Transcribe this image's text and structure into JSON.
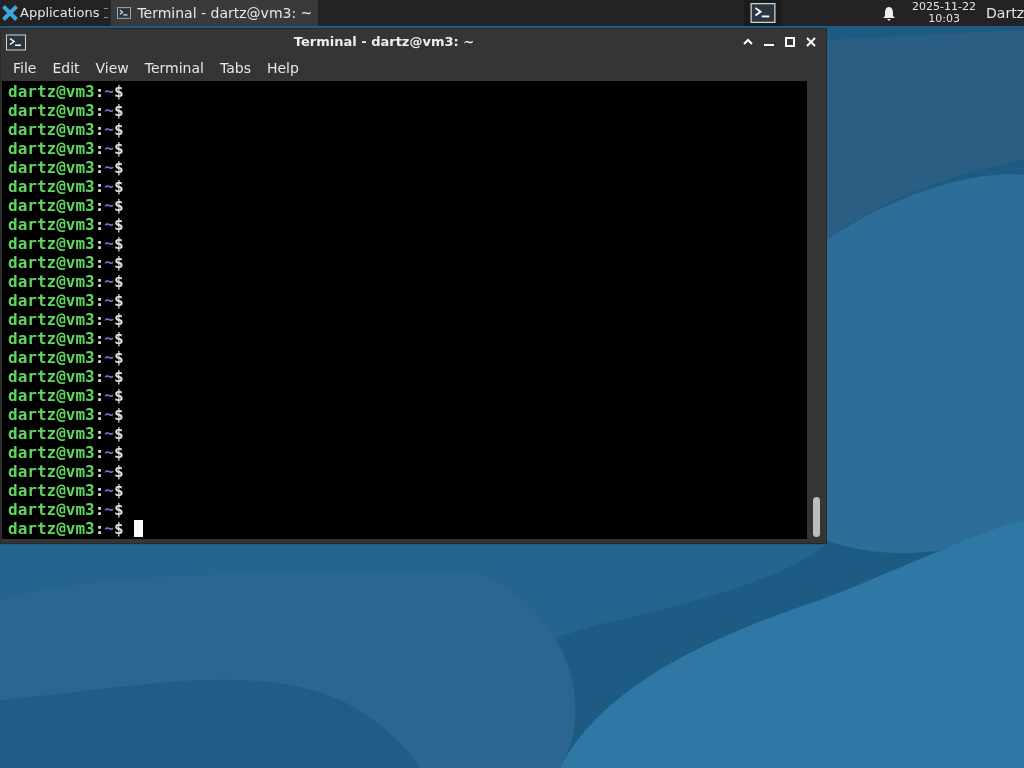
{
  "taskbar": {
    "applications": "Applications",
    "window_button": {
      "title": "Terminal - dartz@vm3: ~",
      "selected": true
    },
    "clock": {
      "date": "2025-11-22",
      "time": "10:03"
    },
    "user": "Dartz"
  },
  "window": {
    "title": "Terminal - dartz@vm3: ~",
    "menu": [
      "File",
      "Edit",
      "View",
      "Terminal",
      "Tabs",
      "Help"
    ],
    "lines": [
      {
        "user_host": "dartz@vm3",
        "separator": ":",
        "path": "~",
        "prompt": "$"
      },
      {
        "user_host": "dartz@vm3",
        "separator": ":",
        "path": "~",
        "prompt": "$"
      },
      {
        "user_host": "dartz@vm3",
        "separator": ":",
        "path": "~",
        "prompt": "$"
      },
      {
        "user_host": "dartz@vm3",
        "separator": ":",
        "path": "~",
        "prompt": "$"
      },
      {
        "user_host": "dartz@vm3",
        "separator": ":",
        "path": "~",
        "prompt": "$"
      },
      {
        "user_host": "dartz@vm3",
        "separator": ":",
        "path": "~",
        "prompt": "$"
      },
      {
        "user_host": "dartz@vm3",
        "separator": ":",
        "path": "~",
        "prompt": "$"
      },
      {
        "user_host": "dartz@vm3",
        "separator": ":",
        "path": "~",
        "prompt": "$"
      },
      {
        "user_host": "dartz@vm3",
        "separator": ":",
        "path": "~",
        "prompt": "$"
      },
      {
        "user_host": "dartz@vm3",
        "separator": ":",
        "path": "~",
        "prompt": "$"
      },
      {
        "user_host": "dartz@vm3",
        "separator": ":",
        "path": "~",
        "prompt": "$"
      },
      {
        "user_host": "dartz@vm3",
        "separator": ":",
        "path": "~",
        "prompt": "$"
      },
      {
        "user_host": "dartz@vm3",
        "separator": ":",
        "path": "~",
        "prompt": "$"
      },
      {
        "user_host": "dartz@vm3",
        "separator": ":",
        "path": "~",
        "prompt": "$"
      },
      {
        "user_host": "dartz@vm3",
        "separator": ":",
        "path": "~",
        "prompt": "$"
      },
      {
        "user_host": "dartz@vm3",
        "separator": ":",
        "path": "~",
        "prompt": "$"
      },
      {
        "user_host": "dartz@vm3",
        "separator": ":",
        "path": "~",
        "prompt": "$"
      },
      {
        "user_host": "dartz@vm3",
        "separator": ":",
        "path": "~",
        "prompt": "$"
      },
      {
        "user_host": "dartz@vm3",
        "separator": ":",
        "path": "~",
        "prompt": "$"
      },
      {
        "user_host": "dartz@vm3",
        "separator": ":",
        "path": "~",
        "prompt": "$"
      },
      {
        "user_host": "dartz@vm3",
        "separator": ":",
        "path": "~",
        "prompt": "$"
      },
      {
        "user_host": "dartz@vm3",
        "separator": ":",
        "path": "~",
        "prompt": "$"
      },
      {
        "user_host": "dartz@vm3",
        "separator": ":",
        "path": "~",
        "prompt": "$"
      },
      {
        "user_host": "dartz@vm3",
        "separator": ":",
        "path": "~",
        "prompt": "$",
        "cursor": true
      }
    ]
  }
}
